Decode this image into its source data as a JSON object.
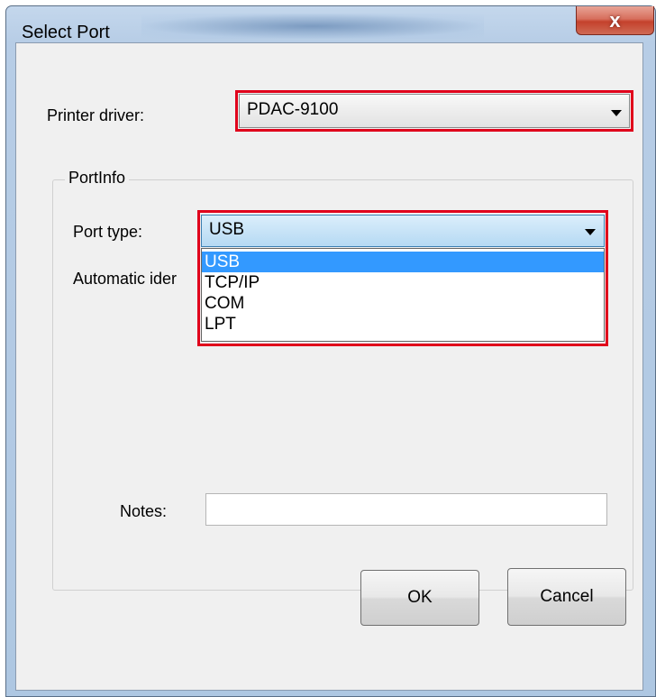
{
  "window": {
    "title": "Select Port",
    "close_glyph": "x"
  },
  "printer_driver": {
    "label": "Printer driver:",
    "value": "PDAC-9100"
  },
  "port_info": {
    "group_title": "PortInfo",
    "port_type": {
      "label": "Port type:",
      "value": "USB",
      "options": [
        "USB",
        "TCP/IP",
        "COM",
        "LPT"
      ],
      "selected_index": 0
    },
    "automatic_label": "Automatic ider",
    "notes": {
      "label": "Notes:",
      "value": ""
    }
  },
  "buttons": {
    "ok": "OK",
    "cancel": "Cancel"
  },
  "colors": {
    "highlight_box": "#e0001b",
    "selection": "#3399ff",
    "close_button": "#c4412c"
  }
}
